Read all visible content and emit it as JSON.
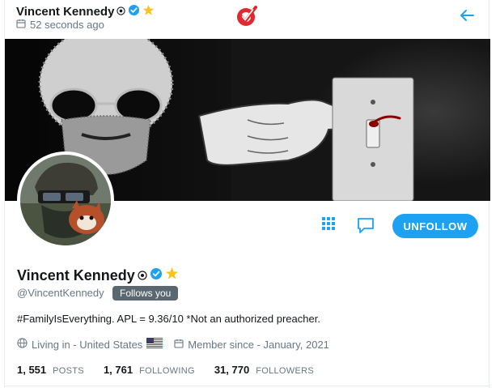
{
  "header": {
    "name": "Vincent Kennedy",
    "time": "52 seconds ago"
  },
  "profile": {
    "name": "Vincent Kennedy",
    "handle": "@VincentKennedy",
    "follows_you": "Follows you",
    "bio": "#FamilyIsEverything. APL = 9.36/10 *Not an authorized preacher.",
    "location": "Living in - United States",
    "member_since": "Member since - January, 2021"
  },
  "actions": {
    "unfollow_label": "UNFOLLOW"
  },
  "stats": [
    {
      "value": "1, 551",
      "label": "POSTS"
    },
    {
      "value": "1, 761",
      "label": "FOLLOWING"
    },
    {
      "value": "31, 770",
      "label": "FOLLOWERS"
    }
  ],
  "colors": {
    "accent": "#1da1f2",
    "gold": "#f5c518",
    "logo_red": "#e0282e",
    "muted": "#657786"
  },
  "icons": [
    "registered-icon",
    "verified-badge-icon",
    "star-badge-icon",
    "calendar-icon",
    "brand-logo-icon",
    "back-arrow-icon",
    "grid-icon",
    "message-icon",
    "globe-icon",
    "us-flag-icon"
  ]
}
